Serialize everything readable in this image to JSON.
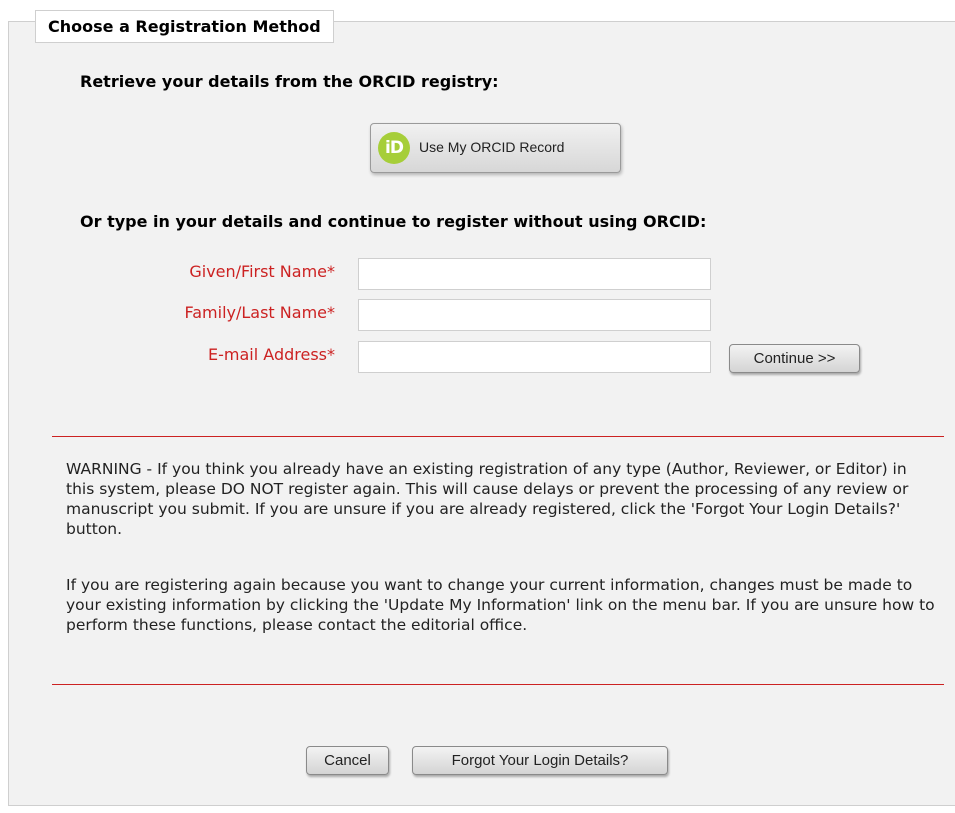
{
  "section": {
    "legend": "Choose a Registration Method"
  },
  "orcid": {
    "heading": "Retrieve your details from the ORCID registry:",
    "icon_text": "iD",
    "icon_color": "#a6ce39",
    "button_label": "Use My ORCID Record"
  },
  "manual": {
    "heading": "Or type in your details and continue to register without using ORCID:",
    "fields": [
      {
        "label": "Given/First Name*",
        "value": "",
        "placeholder": ""
      },
      {
        "label": "Family/Last Name*",
        "value": "",
        "placeholder": ""
      },
      {
        "label": "E-mail Address*",
        "value": "",
        "placeholder": ""
      }
    ],
    "continue_label": "Continue >>",
    "required_color": "#cc2222"
  },
  "warning": {
    "paragraph1": "WARNING - If you think you already have an existing registration of any type (Author, Reviewer, or Editor) in this system, please DO NOT register again. This will cause delays or prevent the processing of any review or manuscript you submit. If you are unsure if you are already registered, click the 'Forgot Your Login Details?' button.",
    "paragraph2": "If you are registering again because you want to change your current information, changes must be made to your existing information by clicking the 'Update My Information' link on the menu bar. If you are unsure how to perform these functions, please contact the editorial office."
  },
  "footer": {
    "cancel_label": "Cancel",
    "forgot_label": "Forgot Your Login Details?"
  }
}
